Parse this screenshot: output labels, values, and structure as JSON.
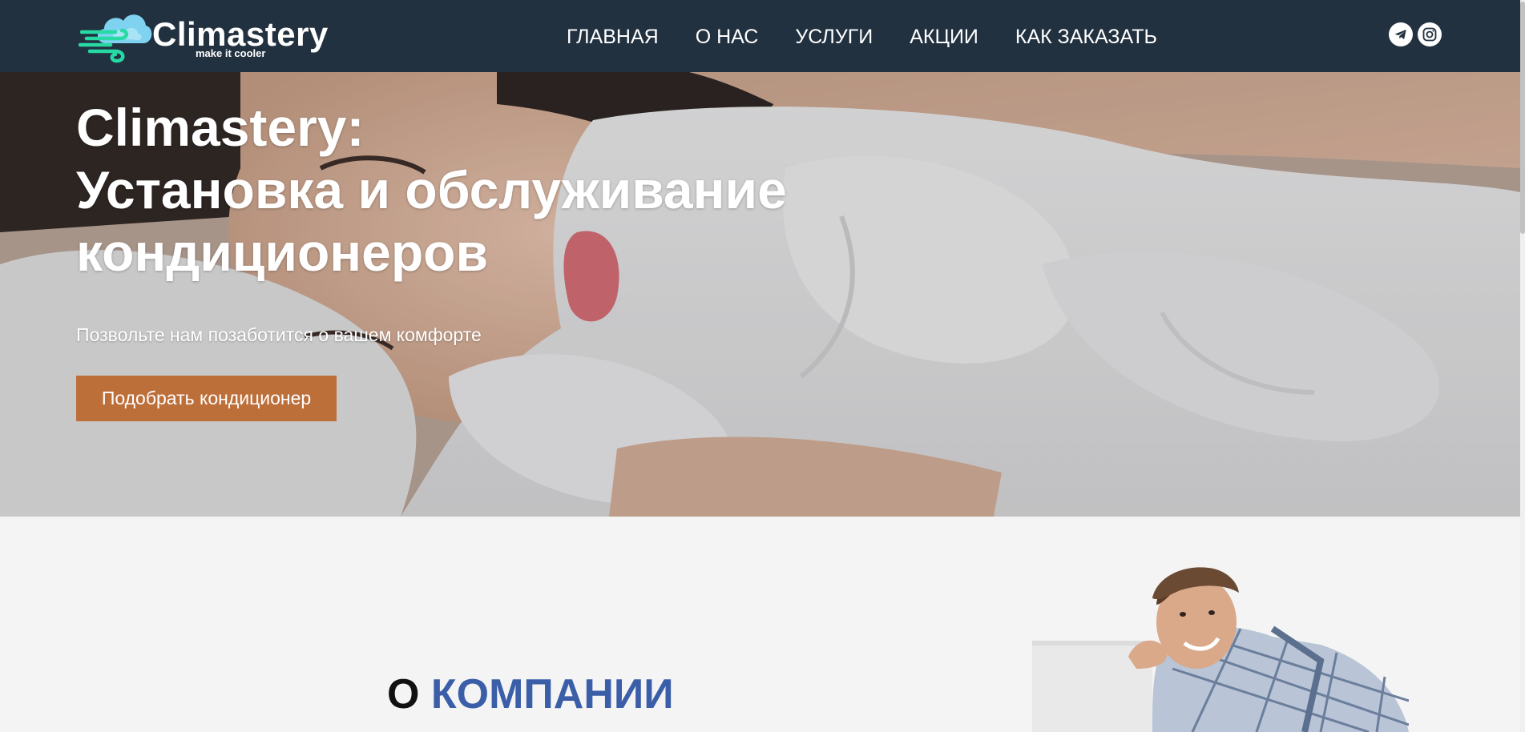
{
  "brand": {
    "name": "Climastery",
    "tagline": "make it cooler"
  },
  "nav": {
    "items": [
      "ГЛАВНАЯ",
      "О НАС",
      "УСЛУГИ",
      "АКЦИИ",
      "КАК ЗАКАЗАТЬ"
    ]
  },
  "social": [
    {
      "icon": "telegram-icon"
    },
    {
      "icon": "instagram-icon"
    }
  ],
  "hero": {
    "title_lines": [
      "Climastery:",
      "Установка и обслуживание",
      "кондиционеров"
    ],
    "subtitle": "Позвольте нам позаботится о вашем комфорте",
    "cta_label": "Подобрать кондиционер"
  },
  "about": {
    "heading_prefix": "О",
    "heading_accent": "КОМПАНИИ"
  },
  "colors": {
    "navbar": "#223140",
    "cta": "#bd6f3a",
    "accent_blue": "#3b5ea8",
    "logo_teal": "#27d9a3",
    "logo_cloud": "#7fd2f0"
  }
}
